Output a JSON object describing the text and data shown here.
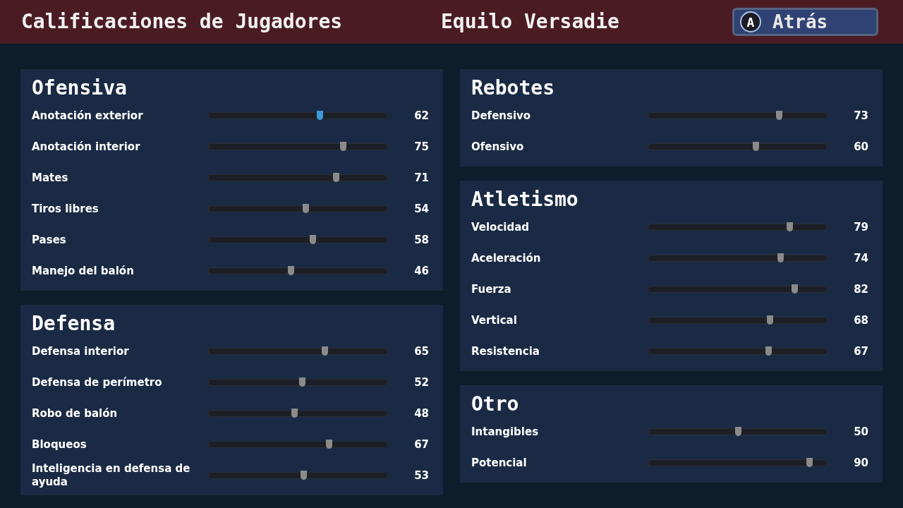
{
  "header": {
    "title": "Calificaciones de Jugadores",
    "player": "Equilo Versadie",
    "back_button": {
      "glyph": "A",
      "label": "Atrás"
    }
  },
  "columns": [
    [
      {
        "title": "Ofensiva",
        "ratings": [
          {
            "label": "Anotación exterior",
            "level": 0.62,
            "value": "62",
            "selected": true
          },
          {
            "label": "Anotación interior",
            "level": 0.75,
            "value": "75",
            "selected": false
          },
          {
            "label": "Mates",
            "level": 0.71,
            "value": "71",
            "selected": false
          },
          {
            "label": "Tiros libres",
            "level": 0.54,
            "value": "54",
            "selected": false
          },
          {
            "label": "Pases",
            "level": 0.58,
            "value": "58",
            "selected": false
          },
          {
            "label": "Manejo del balón",
            "level": 0.46,
            "value": "46",
            "selected": false
          }
        ]
      },
      {
        "title": "Defensa",
        "ratings": [
          {
            "label": "Defensa interior",
            "level": 0.65,
            "value": "65",
            "selected": false
          },
          {
            "label": "Defensa de perímetro",
            "level": 0.52,
            "value": "52",
            "selected": false
          },
          {
            "label": "Robo de balón",
            "level": 0.48,
            "value": "48",
            "selected": false
          },
          {
            "label": "Bloqueos",
            "level": 0.67,
            "value": "67",
            "selected": false
          },
          {
            "label": "Inteligencia en defensa de ayuda",
            "level": 0.53,
            "value": "53",
            "selected": false
          }
        ]
      }
    ],
    [
      {
        "title": "Rebotes",
        "ratings": [
          {
            "label": "Defensivo",
            "level": 0.73,
            "value": "73",
            "selected": false
          },
          {
            "label": "Ofensivo",
            "level": 0.6,
            "value": "60",
            "selected": false
          }
        ]
      },
      {
        "title": "Atletismo",
        "ratings": [
          {
            "label": "Velocidad",
            "level": 0.79,
            "value": "79",
            "selected": false
          },
          {
            "label": "Aceleración",
            "level": 0.74,
            "value": "74",
            "selected": false
          },
          {
            "label": "Fuerza",
            "level": 0.82,
            "value": "82",
            "selected": false
          },
          {
            "label": "Vertical",
            "level": 0.68,
            "value": "68",
            "selected": false
          },
          {
            "label": "Resistencia",
            "level": 0.67,
            "value": "67",
            "selected": false
          }
        ]
      },
      {
        "title": "Otro",
        "ratings": [
          {
            "label": "Intangibles",
            "level": 0.5,
            "value": "50",
            "selected": false
          },
          {
            "label": "Potencial",
            "level": 0.9,
            "value": "90",
            "selected": false
          }
        ]
      }
    ]
  ]
}
